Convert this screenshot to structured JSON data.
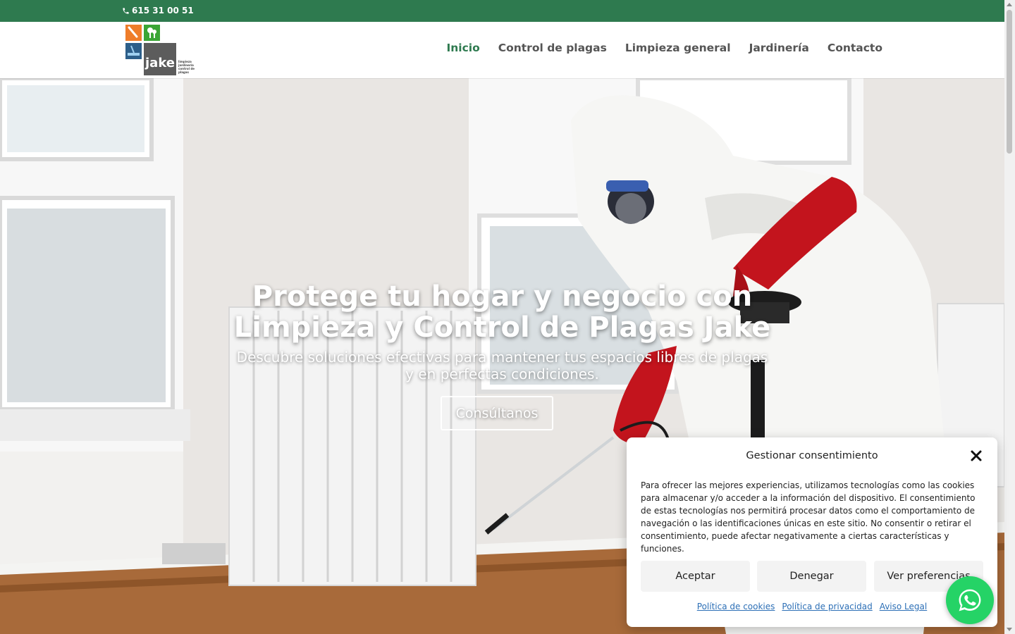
{
  "topbar": {
    "phone": "615 31 00 51"
  },
  "logo": {
    "wordmark": "jake",
    "tagline": "limpieza jardinería control de plagas"
  },
  "nav": {
    "items": [
      {
        "label": "Inicio",
        "active": true
      },
      {
        "label": "Control de plagas"
      },
      {
        "label": "Limpieza general"
      },
      {
        "label": "Jardinería"
      },
      {
        "label": "Contacto"
      }
    ]
  },
  "hero": {
    "title_line1": "Protege tu hogar y negocio con",
    "title_line2": "Limpieza y Control de Plagas Jake",
    "subtitle_line1": "Descubre soluciones efectivas para mantener tus espacios libres de plagas",
    "subtitle_line2": "y en perfectas condiciones.",
    "cta": "Consúltanos"
  },
  "consent": {
    "title": "Gestionar consentimiento",
    "text": "Para ofrecer las mejores experiencias, utilizamos tecnologías como las cookies para almacenar y/o acceder a la información del dispositivo. El consentimiento de estas tecnologías nos permitirá procesar datos como el comportamiento de navegación o las identificaciones únicas en este sitio. No consentir o retirar el consentimiento, puede afectar negativamente a ciertas características y funciones.",
    "accept": "Aceptar",
    "deny": "Denegar",
    "preferences": "Ver preferencias",
    "links": {
      "cookies": "Política de cookies",
      "privacy": "Política de privacidad",
      "legal": "Aviso Legal"
    }
  },
  "colors": {
    "brand_green": "#2e7a4f",
    "nav_text": "#555555",
    "link_blue": "#2c6fb6",
    "whatsapp": "#25d366"
  },
  "icons": {
    "phone": "phone-icon",
    "close": "close-icon",
    "whatsapp": "whatsapp-icon"
  }
}
